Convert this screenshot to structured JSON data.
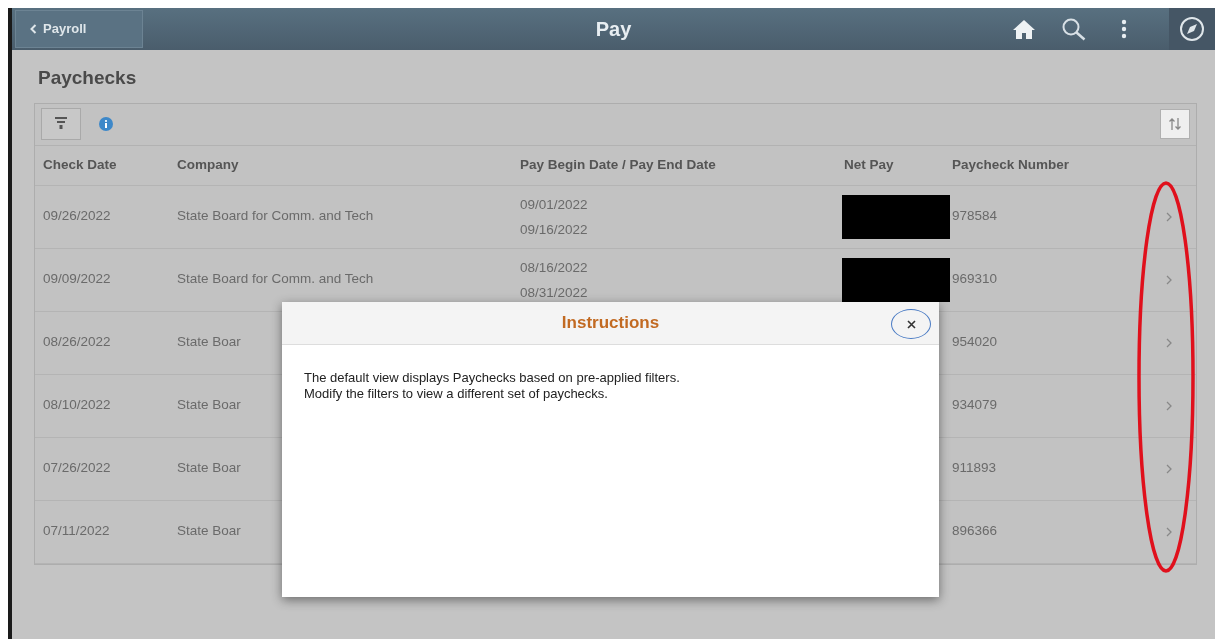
{
  "header": {
    "back_button": "Payroll",
    "title": "Pay"
  },
  "page_title": "Paychecks",
  "table": {
    "columns": [
      "Check Date",
      "Company",
      "Pay Begin Date / Pay End Date",
      "Net Pay",
      "Paycheck Number"
    ],
    "rows": [
      {
        "check_date": "09/26/2022",
        "company": "State Board for Comm. and Tech",
        "pay_begin": "09/01/2022",
        "pay_end": "09/16/2022",
        "net_pay_redacted": true,
        "paycheck_number": "978584"
      },
      {
        "check_date": "09/09/2022",
        "company": "State Board for Comm. and Tech",
        "pay_begin": "08/16/2022",
        "pay_end": "08/31/2022",
        "net_pay_redacted": true,
        "paycheck_number": "969310"
      },
      {
        "check_date": "08/26/2022",
        "company": "State Boar",
        "paycheck_number": "954020"
      },
      {
        "check_date": "08/10/2022",
        "company": "State Boar",
        "paycheck_number": "934079"
      },
      {
        "check_date": "07/26/2022",
        "company": "State Boar",
        "paycheck_number": "911893"
      },
      {
        "check_date": "07/11/2022",
        "company": "State Boar",
        "paycheck_number": "896366"
      }
    ]
  },
  "modal": {
    "title": "Instructions",
    "body": [
      "The default view displays Paychecks based on pre-applied filters.",
      "Modify the filters to view a different set of paychecks."
    ]
  }
}
